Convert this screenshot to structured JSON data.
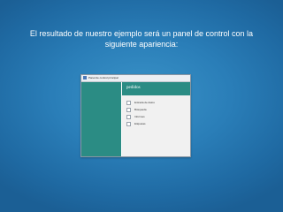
{
  "caption": {
    "line1": "El resultado de nuestro ejemplo será un panel de control con la",
    "line2": "siguiente apariencia:"
  },
  "window": {
    "title": "Panel de control principal",
    "header_title": "pedidos",
    "menu_items": [
      {
        "label": "Entrada de datos"
      },
      {
        "label": "Búsqueda"
      },
      {
        "label": "Informes"
      },
      {
        "label": "Etiquetas"
      }
    ]
  },
  "colors": {
    "background": "#2a7eb8",
    "panel_accent": "#2b8c84",
    "content_bg": "#f1f1f1"
  }
}
